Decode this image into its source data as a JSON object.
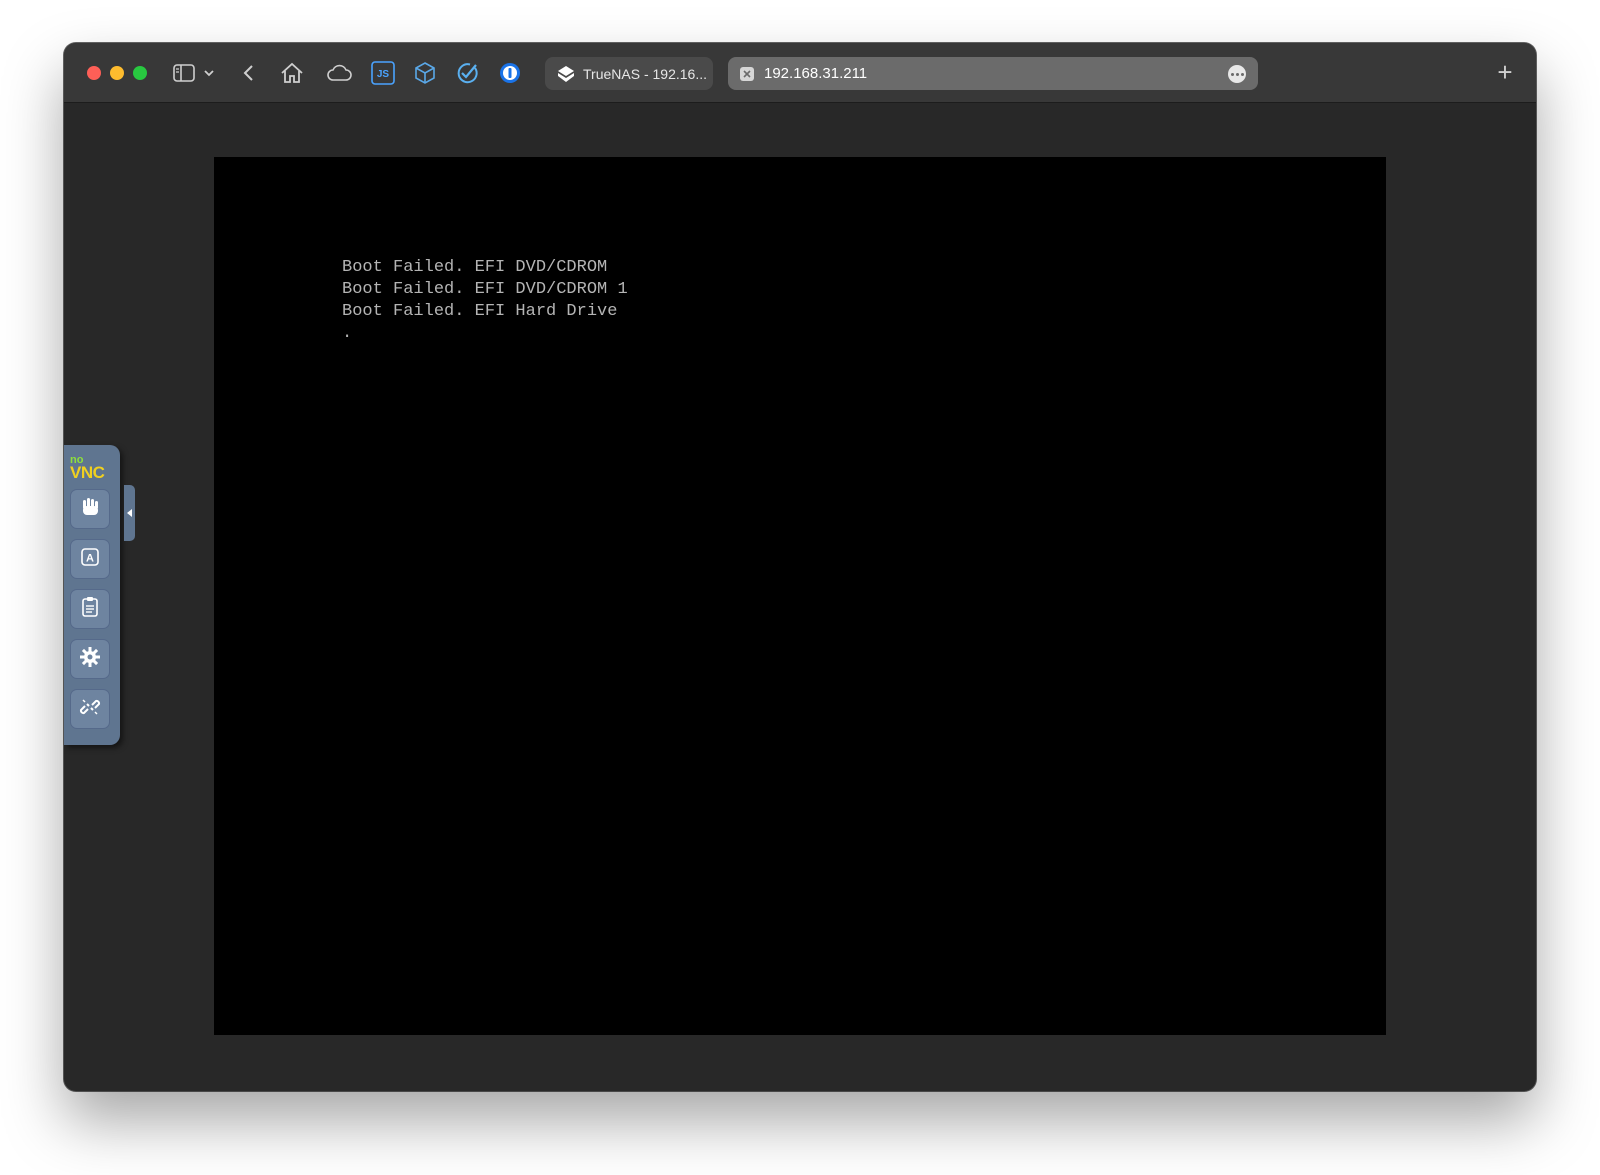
{
  "browser": {
    "tabs": [
      {
        "label": "TrueNAS - 192.16...",
        "favicon": "truenas-logo-icon"
      },
      {
        "label": "192.168.31.211",
        "favicon": "page-icon",
        "active": true
      }
    ],
    "toolbar_icons": [
      "sidebar-icon",
      "chevron-down-icon",
      "back-icon",
      "home-icon",
      "cloud-icon",
      "js-icon",
      "cube-icon",
      "check-circle-icon",
      "onepassword-icon"
    ],
    "new_tab_label": "+",
    "colors": {
      "close": "#fe5f57",
      "minimize": "#febc2e",
      "maximize": "#28c840"
    }
  },
  "console": {
    "lines": [
      "Boot Failed. EFI DVD/CDROM",
      "Boot Failed. EFI DVD/CDROM 1",
      "Boot Failed. EFI Hard Drive",
      "."
    ]
  },
  "novnc": {
    "logo_top": "no",
    "logo_bottom": "VNC",
    "buttons": [
      "drag-hand-icon",
      "keyboard-icon",
      "clipboard-icon",
      "settings-icon",
      "disconnect-icon"
    ]
  }
}
